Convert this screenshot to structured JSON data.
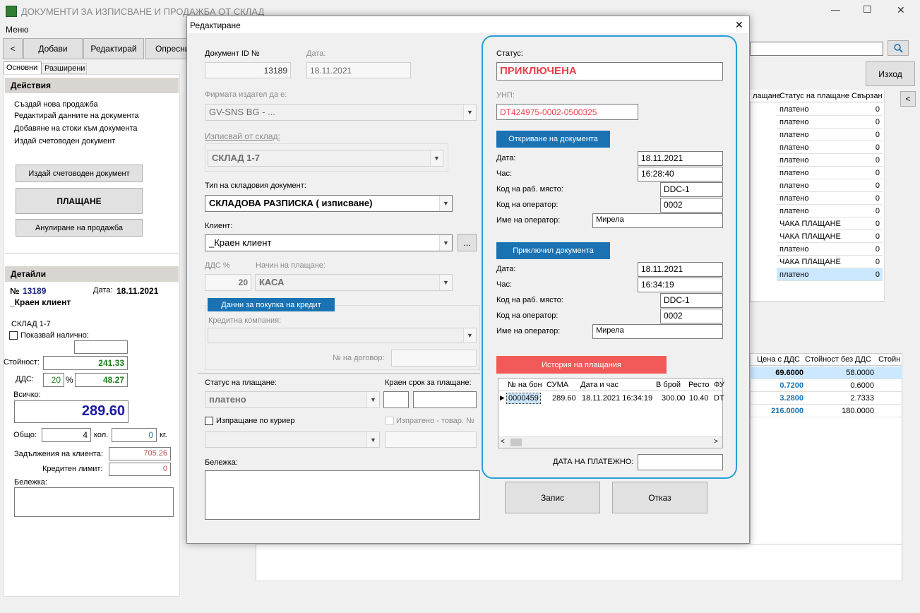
{
  "window": {
    "title": "ДОКУМЕНТИ ЗА ИЗПИСВАНЕ И ПРОДАЖБА ОТ СКЛАД",
    "menu": "Меню",
    "controls": {
      "minimize": "—",
      "maximize": "☐",
      "close": "✕"
    }
  },
  "toolbar": {
    "back": "<",
    "add": "Добави",
    "edit": "Редактирай",
    "refresh": "Опресни",
    "exit": "Изход",
    "search_icon": "magnifier-icon"
  },
  "left_panel": {
    "tabs": [
      "Основни",
      "Разширени"
    ],
    "actions_header": "Действия",
    "actions": [
      "Създай нова продажба",
      "Редактирай данните на документа",
      "Добавяне на стоки към документа",
      "Издай счетоводен документ"
    ],
    "btn_issue": "Издай счетоводен документ",
    "btn_pay": "ПЛАЩАНЕ",
    "btn_cancel": "Анулиране на продажба",
    "details_header": "Детайли",
    "doc_prefix": "№",
    "doc_no": "13189",
    "date_label": "Дата:",
    "date": "18.11.2021",
    "client": "_Краен клиент",
    "warehouse": "СКЛАД 1-7",
    "show_available": "Показвай налично:",
    "value_label": "Стойност:",
    "value": "241.33",
    "vat_label": "ДДС:",
    "vat_pct": "20",
    "pct_sign": "%",
    "vat": "48.27",
    "total_label": "Всичко:",
    "total": "289.60",
    "general_label": "Общо:",
    "qty": "4",
    "qty_unit": "кол.",
    "kg": "0",
    "kg_unit": "кг.",
    "debts_label": "Задължения на клиента:",
    "debts": "705.26",
    "credit_label": "Кредитен лимит:",
    "credit": "0",
    "note_label": "Бележка:"
  },
  "background_grid": {
    "headers": [
      "лащане",
      "Статус на плащане",
      "Свързан"
    ],
    "rows": [
      {
        "status": "платено",
        "n": "0"
      },
      {
        "status": "платено",
        "n": "0"
      },
      {
        "status": "платено",
        "n": "0"
      },
      {
        "status": "платено",
        "n": "0"
      },
      {
        "status": "платено",
        "n": "0"
      },
      {
        "status": "платено",
        "n": "0"
      },
      {
        "status": "платено",
        "n": "0"
      },
      {
        "status": "платено",
        "n": "0"
      },
      {
        "status": "платено",
        "n": "0"
      },
      {
        "status": "ЧАКА ПЛАЩАНЕ",
        "n": "0"
      },
      {
        "status": "ЧАКА ПЛАЩАНЕ",
        "n": "0"
      },
      {
        "status": "платено",
        "n": "0"
      },
      {
        "status": "ЧАКА ПЛАЩАНЕ",
        "n": "0"
      },
      {
        "status": "платено",
        "n": "0"
      }
    ],
    "items_headers": [
      "Цена с ДДС",
      "Стойност без ДДС",
      "Стойн"
    ],
    "items": [
      {
        "price": "69.6000",
        "value": "58.0000"
      },
      {
        "price": "0.7200",
        "value": "0.6000"
      },
      {
        "price": "3.2800",
        "value": "2.7333"
      },
      {
        "price": "216.0000",
        "value": "180.0000"
      }
    ],
    "side_btn": "<"
  },
  "dialog": {
    "title": "Редактиране",
    "close": "✕",
    "doc_id_label": "Документ ID №",
    "doc_id": "13189",
    "date_label": "Дата:",
    "date": "18.11.2021",
    "company_label": "Фирмата издател да е:",
    "company": "GV-SNS BG - ...",
    "warehouse_label": "Изписвай от склад:",
    "warehouse": "СКЛАД 1-7",
    "doc_type_label": "Тип на складовия документ:",
    "doc_type": "СКЛАДОВА РАЗПИСКА ( изписване)",
    "client_label": "Клиент:",
    "client": "_Краен клиент",
    "ellipsis": "...",
    "vat_label": "ДДС %",
    "vat": "20",
    "pay_method_label": "Начин на плащане:",
    "pay_method": "КАСА",
    "credit_btn": "Данни за покупка на кредит",
    "credit_company_label": "Кредитна компания:",
    "contract_label": "№ на договор:",
    "pay_status_label": "Статус на плащане:",
    "pay_status": "платено",
    "deadline_label": "Краен срок за плащане:",
    "courier_label": "Изпращане по куриер",
    "sent_label": "Изпратено - товар. №",
    "note_label": "Бележка:",
    "status_label": "Статус:",
    "status": "ПРИКЛЮЧЕНА",
    "unp_label": "УНП:",
    "unp": "DT424975-0002-0500325",
    "opening_btn": "Откриване на документа",
    "open_date_label": "Дата:",
    "open_date": "18.11.2021",
    "open_time_label": "Час:",
    "open_time": "16:28:40",
    "open_ws_label": "Код на раб. място:",
    "open_ws": "DDC-1",
    "open_op_label": "Код на оператор:",
    "open_op": "0002",
    "open_name_label": "Име на оператор:",
    "open_name": "Мирела",
    "closed_btn": "Приключил документа",
    "close_date_label": "Дата:",
    "close_date": "18.11.2021",
    "close_time_label": "Час:",
    "close_time": "16:34:19",
    "close_ws_label": "Код на раб. място:",
    "close_ws": "DDC-1",
    "close_op_label": "Код на оператор:",
    "close_op": "0002",
    "close_name_label": "Име на оператор:",
    "close_name": "Мирела",
    "history_btn": "История на плащания",
    "history_headers": [
      "№ на бон",
      "СУМА",
      "Дата и час",
      "В брой",
      "Ресто",
      "ФУ"
    ],
    "history_row": [
      "0000459",
      "289.60",
      "18.11.2021 16:34:19",
      "300.00",
      "10.40",
      "DT"
    ],
    "pay_doc_date_label": "ДАТА НА ПЛАТЕЖНО:",
    "save_btn": "Запис",
    "cancel_btn": "Отказ"
  },
  "colors": {
    "accent_blue": "#1a72b3",
    "status_red": "#e8404a",
    "highlight_circle": "#2a9fd6",
    "history_red": "#f25a5a"
  }
}
